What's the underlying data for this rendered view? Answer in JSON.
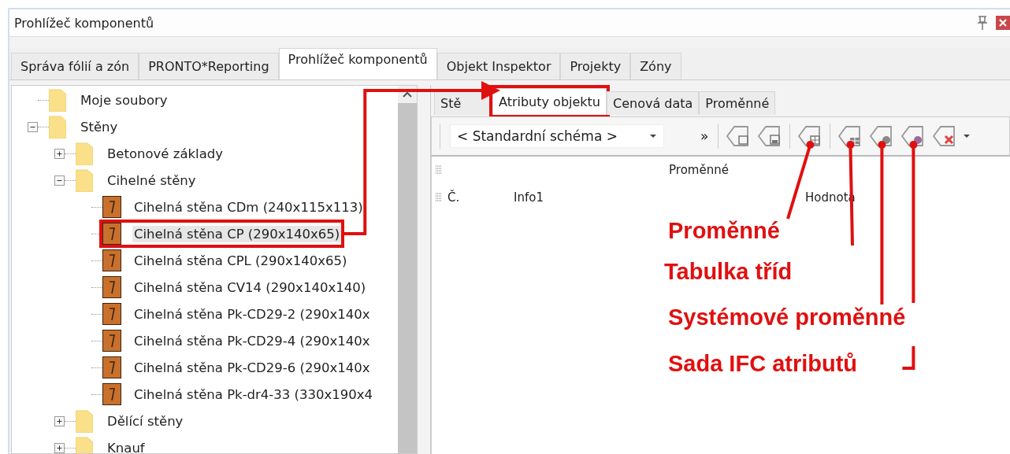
{
  "window": {
    "title": "Prohlížeč komponentů"
  },
  "tabs": [
    {
      "label": "Správa fólií a zón",
      "selected": false
    },
    {
      "label": "PRONTO*Reporting",
      "selected": false
    },
    {
      "label": "Prohlížeč komponentů",
      "selected": true
    },
    {
      "label": "Objekt Inspektor",
      "selected": false
    },
    {
      "label": "Projekty",
      "selected": false
    },
    {
      "label": "Zóny",
      "selected": false
    }
  ],
  "tree": [
    {
      "kind": "folder",
      "label": "Moje soubory",
      "selected": false
    },
    {
      "kind": "folder",
      "label": "Stěny",
      "expanded": true,
      "selected": false,
      "children": [
        {
          "kind": "folder",
          "label": "Betonové základy",
          "expanded": false,
          "selected": false
        },
        {
          "kind": "folder",
          "label": "Cihelné stěny",
          "expanded": true,
          "selected": false,
          "children": [
            {
              "kind": "component",
              "label": "Cihelná stěna CDm (240x115x113)",
              "selected": false
            },
            {
              "kind": "component",
              "label": "Cihelná stěna CP (290x140x65)",
              "selected": true,
              "annotated": true
            },
            {
              "kind": "component",
              "label": "Cihelná stěna CPL (290x140x65)",
              "selected": false
            },
            {
              "kind": "component",
              "label": "Cihelná stěna CV14 (290x140x140)",
              "selected": false
            },
            {
              "kind": "component",
              "label": "Cihelná stěna Pk-CD29-2 (290x140x",
              "selected": false
            },
            {
              "kind": "component",
              "label": "Cihelná stěna Pk-CD29-4 (290x140x",
              "selected": false
            },
            {
              "kind": "component",
              "label": "Cihelná stěna Pk-CD29-6 (290x140x",
              "selected": false
            },
            {
              "kind": "component",
              "label": "Cihelná stěna Pk-dr4-33 (330x190x4",
              "selected": false
            }
          ]
        },
        {
          "kind": "folder",
          "label": "Dělící stěny",
          "expanded": false,
          "selected": false
        },
        {
          "kind": "folder",
          "label": "Knauf",
          "expanded": false,
          "selected": false
        }
      ]
    }
  ],
  "detail_tabs": [
    {
      "label": "Stě",
      "selected": false,
      "annotated": false
    },
    {
      "label": "Atributy objektu",
      "selected": true,
      "annotated": true
    },
    {
      "label": "Cenová data",
      "selected": false,
      "annotated": false
    },
    {
      "label": "Proměnné",
      "selected": false,
      "annotated": false
    }
  ],
  "toolbar": {
    "schema": "< Standardní schéma >",
    "overflow": "»"
  },
  "grid": {
    "group_header": "Proměnné",
    "columns": [
      "Č.",
      "Info1",
      "Hodnota"
    ]
  },
  "annotations": [
    "Proměnné",
    "Tabulka tříd",
    "Systémové proměnné",
    "Sada IFC atributů"
  ]
}
